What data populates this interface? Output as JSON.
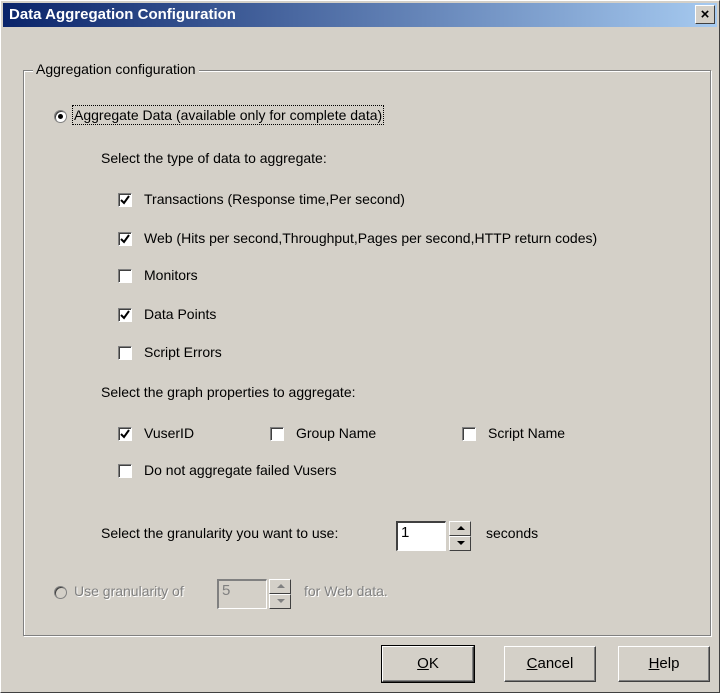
{
  "window": {
    "title": "Data Aggregation Configuration",
    "close_glyph": "×"
  },
  "group": {
    "label": "Aggregation configuration"
  },
  "aggregate_radio": {
    "label": "Aggregate Data (available only for complete data)",
    "selected": true
  },
  "data_types": {
    "heading": "Select the type of data to aggregate:",
    "items": [
      {
        "label": "Transactions (Response time,Per second)",
        "checked": true
      },
      {
        "label": "Web (Hits per second,Throughput,Pages per second,HTTP return codes)",
        "checked": true
      },
      {
        "label": "Monitors",
        "checked": false
      },
      {
        "label": "Data Points",
        "checked": true
      },
      {
        "label": "Script Errors",
        "checked": false
      }
    ]
  },
  "graph_props": {
    "heading": "Select the graph properties to aggregate:",
    "vuserid": {
      "label": "VuserID",
      "checked": true
    },
    "group_name": {
      "label": "Group Name",
      "checked": false
    },
    "script_name": {
      "label": "Script Name",
      "checked": false
    },
    "failed_vusers": {
      "label": "Do not aggregate failed Vusers",
      "checked": false
    }
  },
  "granularity": {
    "label": "Select the granularity you want to use:",
    "value": "1",
    "unit": "seconds"
  },
  "web_granularity": {
    "label_prefix": "Use granularity of",
    "value": "5",
    "label_suffix": "for Web data.",
    "enabled": false
  },
  "buttons": {
    "ok": {
      "mnemonic": "O",
      "rest": "K"
    },
    "cancel": {
      "mnemonic": "C",
      "rest": "ancel"
    },
    "help": {
      "mnemonic": "H",
      "rest": "elp"
    }
  }
}
